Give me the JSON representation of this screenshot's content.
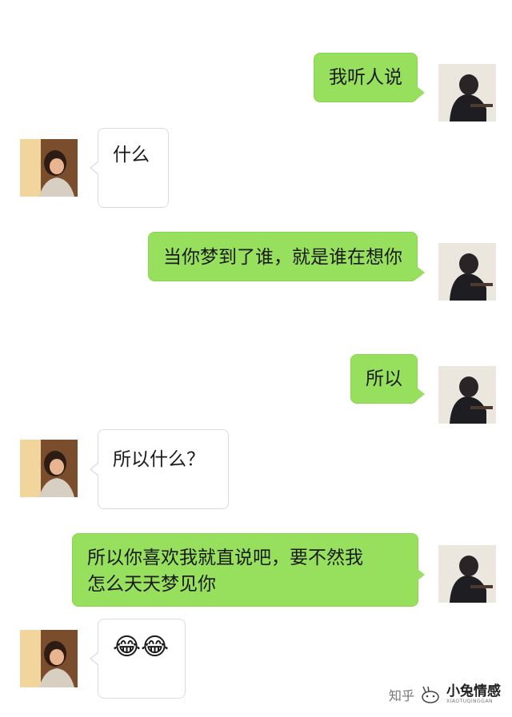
{
  "chat": {
    "messages": [
      {
        "sender": "self",
        "text": "我听人说"
      },
      {
        "sender": "other",
        "text": "什么"
      },
      {
        "sender": "self",
        "text": "当你梦到了谁，就是谁在想你"
      },
      {
        "sender": "self",
        "text": "所以"
      },
      {
        "sender": "other",
        "text": "所以什么？"
      },
      {
        "sender": "self",
        "lines": [
          "所以你喜欢我就直说吧，要不然我",
          "怎么天天梦见你"
        ]
      },
      {
        "sender": "other",
        "text": "😂😂"
      }
    ]
  },
  "watermark": {
    "site": "知乎",
    "brand": "小兔情感",
    "brand_sub": "XIAOTUQINGGAN"
  },
  "colors": {
    "self_bubble": "#97e05e",
    "other_bubble": "#ffffff",
    "background": "#ffffff"
  }
}
